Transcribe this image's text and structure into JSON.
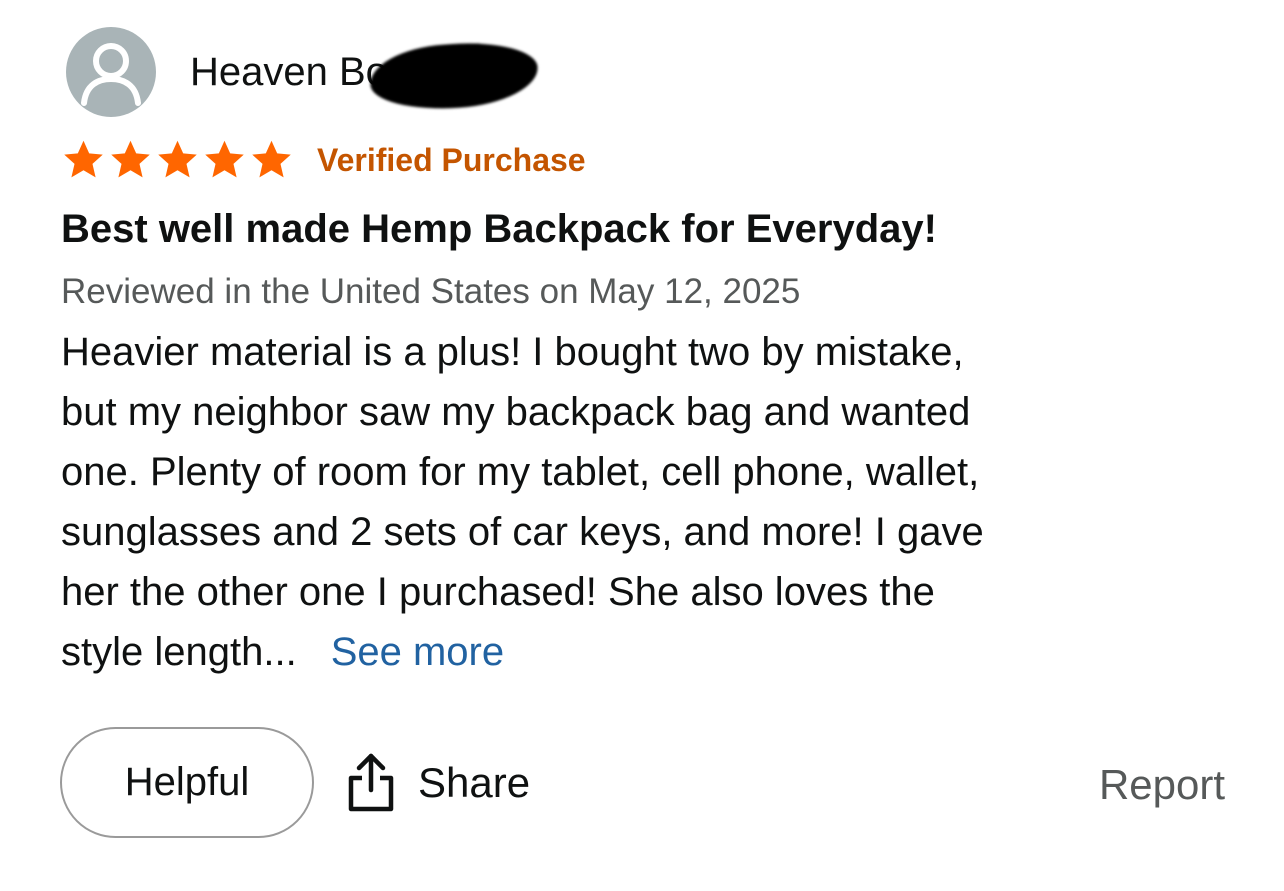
{
  "reviewer": {
    "name": "Heaven Bou",
    "avatar_icon": "person-silhouette-icon"
  },
  "rating": {
    "stars": 5,
    "max_stars": 5,
    "star_color": "#ff6600",
    "verified_label": "Verified Purchase",
    "verified_color": "#c45500"
  },
  "review": {
    "title": "Best well made Hemp Backpack for Everyday!",
    "meta": "Reviewed in the United States on May 12, 2025",
    "body_lines": [
      "Heavier material is a plus! I bought two by mistake,",
      "but my neighbor saw my backpack bag and wanted",
      "one. Plenty of room for my tablet, cell phone, wallet,",
      "sunglasses and 2 sets of car keys, and more! I gave",
      "her the other one I purchased! She also loves the",
      "style length..."
    ],
    "see_more_label": "See more",
    "link_color": "#2162a1"
  },
  "actions": {
    "helpful_label": "Helpful",
    "share_label": "Share",
    "share_icon": "share-upload-icon",
    "report_label": "Report"
  }
}
